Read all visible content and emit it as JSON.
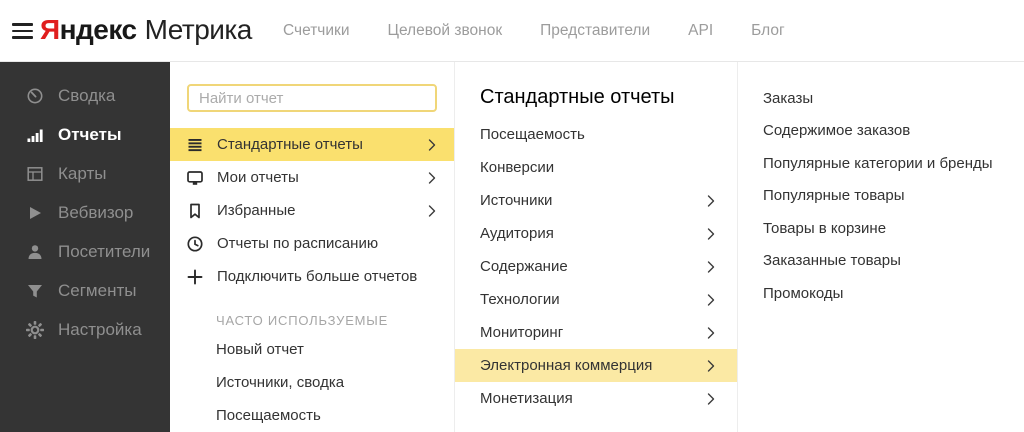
{
  "header": {
    "logo": {
      "brand_initial": "Я",
      "brand_rest": "ндекс",
      "product": "Метрика"
    },
    "nav": [
      "Счетчики",
      "Целевой звонок",
      "Представители",
      "API",
      "Блог"
    ]
  },
  "sidebar": {
    "items": [
      {
        "label": "Сводка",
        "icon": "gauge-icon",
        "active": false
      },
      {
        "label": "Отчеты",
        "icon": "bar-chart-icon",
        "active": true
      },
      {
        "label": "Карты",
        "icon": "layout-icon",
        "active": false
      },
      {
        "label": "Вебвизор",
        "icon": "play-icon",
        "active": false
      },
      {
        "label": "Посетители",
        "icon": "person-icon",
        "active": false
      },
      {
        "label": "Сегменты",
        "icon": "funnel-icon",
        "active": false
      },
      {
        "label": "Настройка",
        "icon": "gear-icon",
        "active": false
      }
    ]
  },
  "reports_menu": {
    "search_placeholder": "Найти отчет",
    "items": [
      {
        "label": "Стандартные отчеты",
        "icon": "lines-icon",
        "chevron": true,
        "selected": true
      },
      {
        "label": "Мои отчеты",
        "icon": "monitor-icon",
        "chevron": true,
        "selected": false
      },
      {
        "label": "Избранные",
        "icon": "bookmark-icon",
        "chevron": true,
        "selected": false
      },
      {
        "label": "Отчеты по расписанию",
        "icon": "clock-icon",
        "chevron": false,
        "selected": false
      },
      {
        "label": "Подключить больше отчетов",
        "icon": "plus-icon",
        "chevron": false,
        "selected": false
      }
    ],
    "section_title": "ЧАСТО ИСПОЛЬЗУЕМЫЕ",
    "frequent_items": [
      "Новый отчет",
      "Источники, сводка",
      "Посещаемость"
    ]
  },
  "standard_reports": {
    "title": "Стандартные отчеты",
    "items": [
      {
        "label": "Посещаемость",
        "chevron": false,
        "selected": false
      },
      {
        "label": "Конверсии",
        "chevron": false,
        "selected": false
      },
      {
        "label": "Источники",
        "chevron": true,
        "selected": false
      },
      {
        "label": "Аудитория",
        "chevron": true,
        "selected": false
      },
      {
        "label": "Содержание",
        "chevron": true,
        "selected": false
      },
      {
        "label": "Технологии",
        "chevron": true,
        "selected": false
      },
      {
        "label": "Мониторинг",
        "chevron": true,
        "selected": false
      },
      {
        "label": "Электронная коммерция",
        "chevron": true,
        "selected": true
      },
      {
        "label": "Монетизация",
        "chevron": true,
        "selected": false
      }
    ]
  },
  "ecommerce_submenu": {
    "items": [
      "Заказы",
      "Содержимое заказов",
      "Популярные категории и бренды",
      "Популярные товары",
      "Товары в корзине",
      "Заказанные товары",
      "Промокоды"
    ]
  },
  "colors": {
    "brand_red": "#e01e1e",
    "sidebar_bg": "#343434",
    "selected_yellow": "#fae06e",
    "selected_yellow_pale": "#fbe9a4",
    "search_border_yellow": "#f0d678"
  }
}
